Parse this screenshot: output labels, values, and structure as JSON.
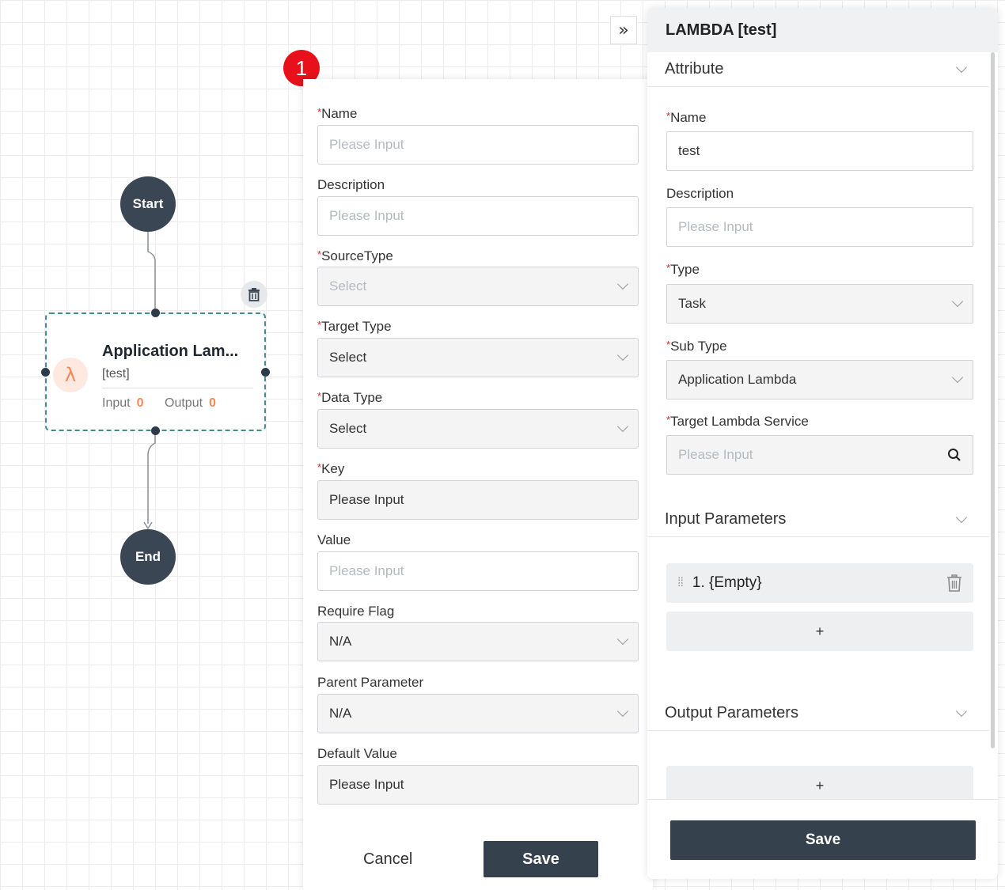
{
  "canvas": {
    "start_label": "Start",
    "end_label": "End",
    "task_node": {
      "title": "Application Lam...",
      "subtitle": "[test]",
      "input_label": "Input",
      "input_count": "0",
      "output_label": "Output",
      "output_count": "0",
      "badge_icon": "lambda-icon",
      "accent_color": "#f08a5d"
    }
  },
  "step_badge": "1",
  "form": {
    "name": {
      "label": "Name",
      "required": "*",
      "placeholder": "Please Input"
    },
    "description": {
      "label": "Description",
      "placeholder": "Please Input"
    },
    "source_type": {
      "label": "SourceType",
      "required": "*",
      "placeholder": "Select"
    },
    "target_type": {
      "label": "Target Type",
      "required": "*",
      "value": "Select"
    },
    "data_type": {
      "label": "Data Type",
      "required": "*",
      "value": "Select"
    },
    "key": {
      "label": "Key",
      "required": "*",
      "value": "Please Input"
    },
    "value": {
      "label": "Value",
      "placeholder": "Please Input"
    },
    "require_flag": {
      "label": "Require Flag",
      "value": "N/A"
    },
    "parent_parameter": {
      "label": "Parent Parameter",
      "value": "N/A"
    },
    "default_value": {
      "label": "Default Value",
      "value": "Please Input"
    },
    "cancel_label": "Cancel",
    "save_label": "Save"
  },
  "panel": {
    "title": "LAMBDA [test]",
    "collapse_icon": "double-chevron-right-icon",
    "attribute": {
      "header": "Attribute",
      "name": {
        "label": "Name",
        "required": "*",
        "value": "test"
      },
      "description": {
        "label": "Description",
        "placeholder": "Please Input"
      },
      "type": {
        "label": "Type",
        "required": "*",
        "value": "Task"
      },
      "sub_type": {
        "label": "Sub Type",
        "required": "*",
        "value": "Application Lambda"
      },
      "target_lambda_service": {
        "label": "Target Lambda Service",
        "required": "*",
        "placeholder": "Please Input"
      }
    },
    "input_parameters": {
      "header": "Input Parameters",
      "items": [
        {
          "label": "1. {Empty}"
        }
      ],
      "add_label": "+"
    },
    "output_parameters": {
      "header": "Output Parameters",
      "add_label": "+"
    },
    "save_label": "Save"
  },
  "colors": {
    "dark": "#36414e",
    "required": "#e02020",
    "step_badge": "#e8111b",
    "node_border": "#3f8f8a"
  }
}
